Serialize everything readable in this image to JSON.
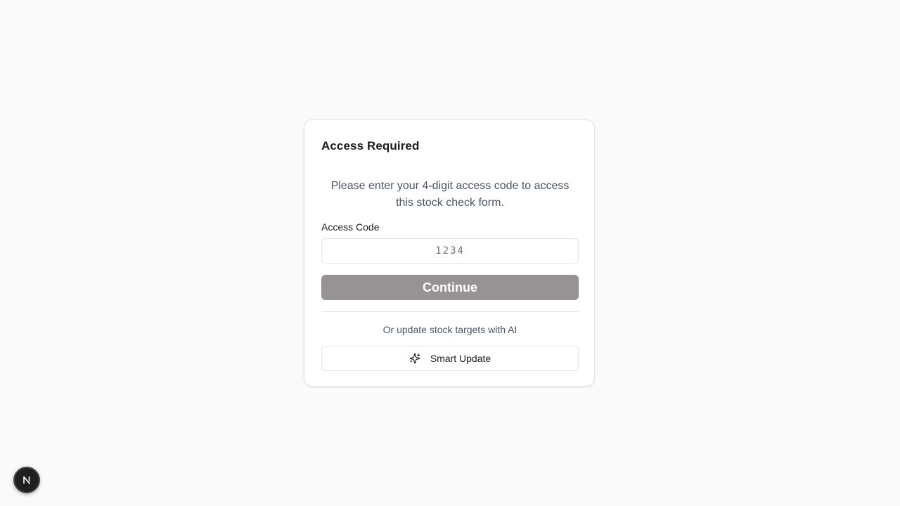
{
  "card": {
    "title": "Access Required",
    "description": "Please enter your 4-digit access code to access this stock check form.",
    "field_label": "Access Code",
    "code_input": {
      "value": "",
      "placeholder": "1234"
    },
    "continue_label": "Continue",
    "ai_prompt": "Or update stock targets with AI",
    "smart_update_label": "Smart Update",
    "smart_update_icon": "sparkles-icon"
  },
  "dev_badge": {
    "icon": "nextjs-logo-icon",
    "letter": "N"
  },
  "colors": {
    "background": "#fafafa",
    "continue_disabled": "#979394",
    "badge": "#1f1f1f"
  }
}
